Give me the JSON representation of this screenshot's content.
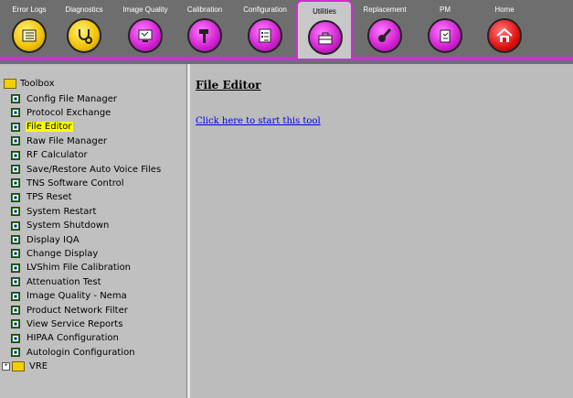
{
  "tabs": [
    {
      "label": "Error Logs"
    },
    {
      "label": "Diagnostics"
    },
    {
      "label": "Image Quality"
    },
    {
      "label": "Calibration"
    },
    {
      "label": "Configuration"
    },
    {
      "label": "Utilities"
    },
    {
      "label": "Replacement"
    },
    {
      "label": "PM"
    },
    {
      "label": "Home"
    }
  ],
  "active_tab": "Utilities",
  "colors": {
    "accent": "#d42bd4",
    "link": "#0000ee",
    "selected": "#ffff00"
  },
  "sidebar": {
    "root_label": "Toolbox",
    "items": [
      {
        "label": "Config File Manager"
      },
      {
        "label": "Protocol Exchange"
      },
      {
        "label": "File Editor"
      },
      {
        "label": "Raw File Manager"
      },
      {
        "label": "RF Calculator"
      },
      {
        "label": "Save/Restore Auto Voice Files"
      },
      {
        "label": "TNS Software Control"
      },
      {
        "label": "TPS Reset"
      },
      {
        "label": "System Restart"
      },
      {
        "label": "System Shutdown"
      },
      {
        "label": "Display IQA"
      },
      {
        "label": "Change Display"
      },
      {
        "label": "LVShim File Calibration"
      },
      {
        "label": "Attenuation Test"
      },
      {
        "label": "Image Quality - Nema"
      },
      {
        "label": "Product Network Filter"
      },
      {
        "label": "View Service Reports"
      },
      {
        "label": "HIPAA Configuration"
      },
      {
        "label": "Autologin Configuration"
      }
    ],
    "selected": "File Editor",
    "collapsed_folder": {
      "label": "VRE"
    }
  },
  "main": {
    "title": "File Editor",
    "link_text": "Click here to start this tool"
  }
}
